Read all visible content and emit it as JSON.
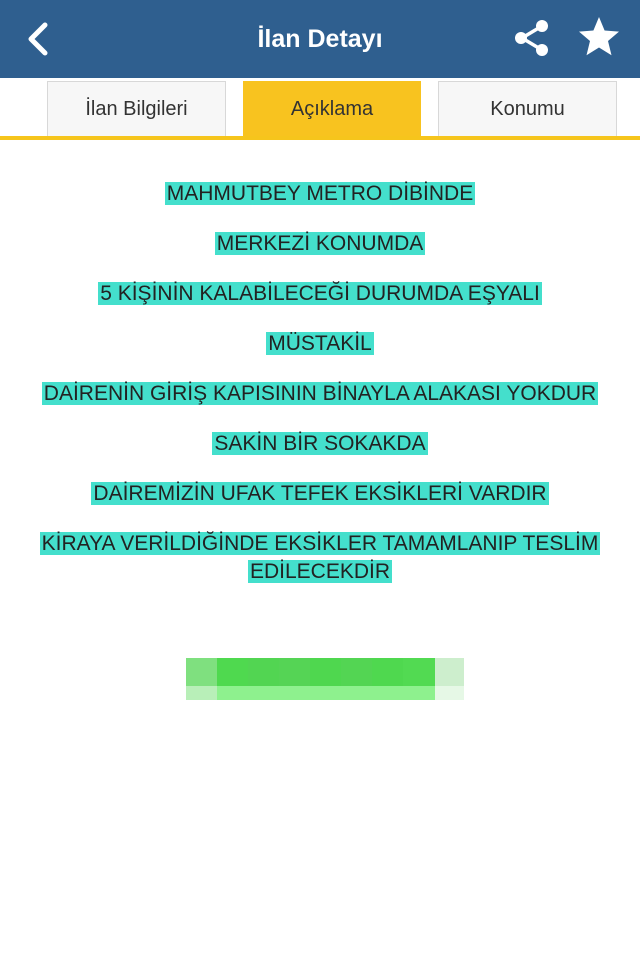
{
  "header": {
    "title": "İlan Detayı",
    "back_icon": "chevron-left-icon",
    "share_icon": "share-icon",
    "star_icon": "star-icon",
    "background_color": "#2f5f8f"
  },
  "tabs": [
    {
      "label": "İlan Bilgileri",
      "active": false
    },
    {
      "label": "Açıklama",
      "active": true
    },
    {
      "label": "Konumu",
      "active": false
    }
  ],
  "accent_color": "#f8c31f",
  "highlight_color": "#44dfcc",
  "description": {
    "lines": [
      "MAHMUTBEY METRO DİBİNDE",
      "MERKEZİ KONUMDA",
      "5 KİŞİNİN KALABİLECEĞİ DURUMDA EŞYALI",
      "MÜSTAKİL",
      "DAİRENİN GİRİŞ KAPISININ BİNAYLA ALAKASI YOKDUR",
      "SAKİN BİR SOKAKDA",
      "DAİREMİZİN UFAK TEFEK EKSİKLERİ VARDIR",
      "KİRAYA VERİLDİĞİNDE EKSİKLER TAMAMLANIP TESLİM EDİLECEKDİR"
    ]
  }
}
